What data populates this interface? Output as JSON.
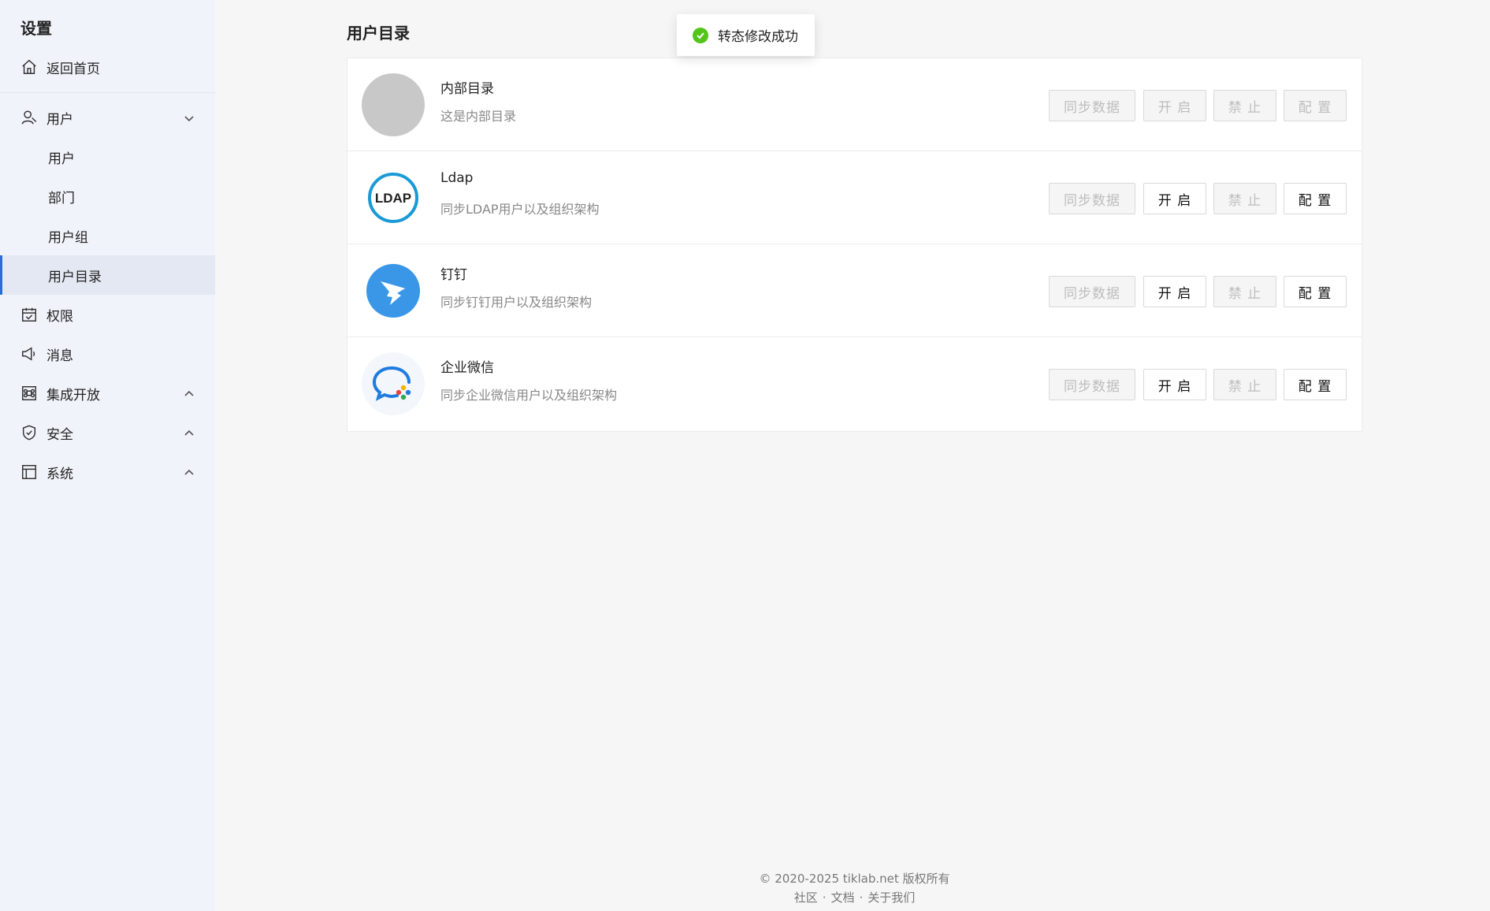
{
  "sidebar": {
    "title": "设置",
    "home": "返回首页",
    "user_group": {
      "label": "用户",
      "children": [
        "用户",
        "部门",
        "用户组",
        "用户目录"
      ],
      "active": "用户目录"
    },
    "permission": "权限",
    "message": "消息",
    "integration": "集成开放",
    "security": "安全",
    "system": "系统"
  },
  "main": {
    "title": "用户目录",
    "directories": [
      {
        "name": "内部目录",
        "desc": "这是内部目录",
        "logo": "gray-circle",
        "sync": "同步数据",
        "open": "开 启",
        "ban": "禁 止",
        "config": "配 置",
        "sync_enabled": false,
        "open_enabled": false,
        "ban_enabled": false,
        "config_enabled": false
      },
      {
        "name": "Ldap",
        "desc": "同步LDAP用户以及组织架构",
        "logo": "ldap-logo",
        "logo_text": "LDAP",
        "sync": "同步数据",
        "open": "开 启",
        "ban": "禁 止",
        "config": "配 置",
        "sync_enabled": false,
        "open_enabled": true,
        "ban_enabled": false,
        "config_enabled": true
      },
      {
        "name": "钉钉",
        "desc": "同步钉钉用户以及组织架构",
        "logo": "dingtalk-logo",
        "sync": "同步数据",
        "open": "开 启",
        "ban": "禁 止",
        "config": "配 置",
        "sync_enabled": false,
        "open_enabled": true,
        "ban_enabled": false,
        "config_enabled": true
      },
      {
        "name": "企业微信",
        "desc": "同步企业微信用户以及组织架构",
        "logo": "wecom-logo",
        "sync": "同步数据",
        "open": "开 启",
        "ban": "禁 止",
        "config": "配 置",
        "sync_enabled": false,
        "open_enabled": true,
        "ban_enabled": false,
        "config_enabled": true
      }
    ]
  },
  "toast": {
    "message": "转态修改成功",
    "icon": "check-circle-icon",
    "color": "#52c41a"
  },
  "footer": {
    "copyright": "© 2020-2025 tiklab.net 版权所有",
    "links": [
      "社区",
      "文档",
      "关于我们"
    ]
  },
  "colors": {
    "sidebar_bg": "#f0f3fa",
    "active_item_bg": "#e3e8f2",
    "accent": "#2b6cd9",
    "page_bg": "#f6f6f6"
  }
}
